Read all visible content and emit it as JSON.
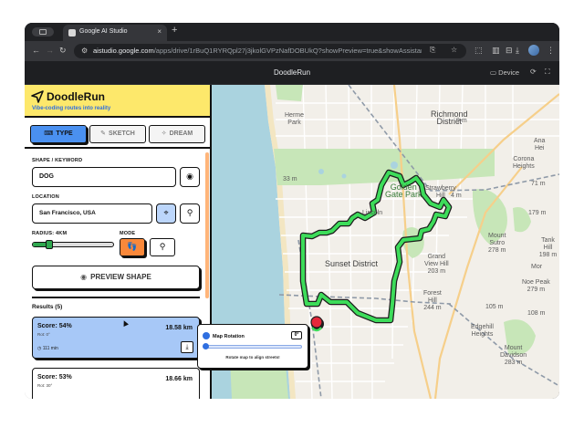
{
  "browser": {
    "tab_title": "Google AI Studio",
    "tab_close": "×",
    "new_tab": "+",
    "url_host": "aistudio.google.com",
    "url_path": "/apps/drive/1rBuQ1RYRQpl27j3jkolGVPzNafDOBUkQ?showPreview=true&showAssistant...",
    "back": "←",
    "forward": "→",
    "reload": "↻"
  },
  "app_bar": {
    "title": "DoodleRun",
    "device_label": "Device"
  },
  "brand": {
    "name": "DoodleRun",
    "tagline": "Vibe-coding routes into reality",
    "color": "#fde86b"
  },
  "modes": [
    {
      "label": "TYPE",
      "icon": "keyboard-icon",
      "active": true
    },
    {
      "label": "SKETCH",
      "icon": "pencil-icon",
      "active": false
    },
    {
      "label": "DREAM",
      "icon": "sparkles-icon",
      "active": false
    }
  ],
  "form": {
    "shape_label": "SHAPE / KEYWORD",
    "shape_value": "DOG",
    "location_label": "LOCATION",
    "location_value": "San Francisco, USA",
    "radius_label": "RADIUS: 4KM",
    "radius_fraction": 0.2,
    "mode_label": "MODE",
    "modes": [
      "run",
      "bike"
    ],
    "mode_selected": "run",
    "preview_label": "PREVIEW SHAPE"
  },
  "results": {
    "title": "Results (5)",
    "items": [
      {
        "score": "Score: 54%",
        "rot": "Rot: 0°",
        "distance": "18.58 km",
        "time": "111 min",
        "selected": true
      },
      {
        "score": "Score: 53%",
        "rot": "Rot: 30°",
        "distance": "18.66 km",
        "selected": false
      }
    ]
  },
  "map": {
    "labels": {
      "richmond": "Richmond\nDistrict",
      "sunset": "Sunset District",
      "golden_gate": "Golden\nGate Park",
      "hermel": "Herme\nPark",
      "ana": "Ana\nHei",
      "corona": "Corona\nHeights",
      "sutro": "Mount\nSutro\n278 m",
      "tank": "Tank Hill\n198 m",
      "grandview": "Grand\nView Hill\n203 m",
      "noe": "Noe Peak\n279 m",
      "forest": "Forest\nHill\n244 m",
      "edgehill": "Edgehill\nHeights",
      "davidson": "Mount\nDavidson\n283 m",
      "strawberry": "Strawberry\nHill",
      "lincoln": "Lincoln",
      "elev_a": "4 m",
      "elev_b": "179 m",
      "elev_c": "71 m",
      "elev_d": "9 m",
      "elev_e": "33 m",
      "elev_f": "108 m",
      "elev_g": "105 m",
      "mor": "Mor"
    },
    "route_color": "#3ddc5a",
    "route_outline": "#1d1d1d"
  },
  "rotation": {
    "title": "Map Rotation",
    "value": "0°",
    "hint": "Rotate map to align streets!",
    "fraction": 0
  }
}
